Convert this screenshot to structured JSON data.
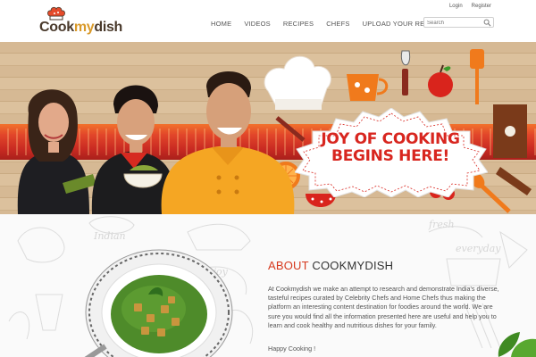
{
  "header": {
    "logo": {
      "part1": "Cook",
      "part2": "my",
      "part3": "dish"
    },
    "top_links": [
      "Login",
      "Register"
    ],
    "nav": [
      "HOME",
      "VIDEOS",
      "RECIPES",
      "CHEFS",
      "UPLOAD YOUR RECIPE"
    ],
    "search": {
      "placeholder": "Search"
    }
  },
  "hero": {
    "badge_line1": "JOY OF COOKING",
    "badge_line2": "BEGINS HERE!"
  },
  "about": {
    "title_prefix": "ABOUT",
    "title_brand": "COOKMYDISH",
    "body": "At Cookmydish we make an attempt to research and demonstrate India's diverse, tasteful recipes curated by Celebrity Chefs and Home Chefs thus making the platform an interesting content destination for foodies around the world. We are sure you would find all the information presented here are useful and help you to learn and cook healthy and nutritious dishes for your family.",
    "sign_off": "Happy Cooking !"
  },
  "colors": {
    "accent_red": "#d6391e",
    "logo_brown": "#4a3a2c",
    "logo_gold": "#d99a2b",
    "ribbon_red": "#c92a22",
    "chef_yellow": "#f5a623"
  },
  "icons": [
    "chef-hat-icon",
    "search-icon"
  ]
}
